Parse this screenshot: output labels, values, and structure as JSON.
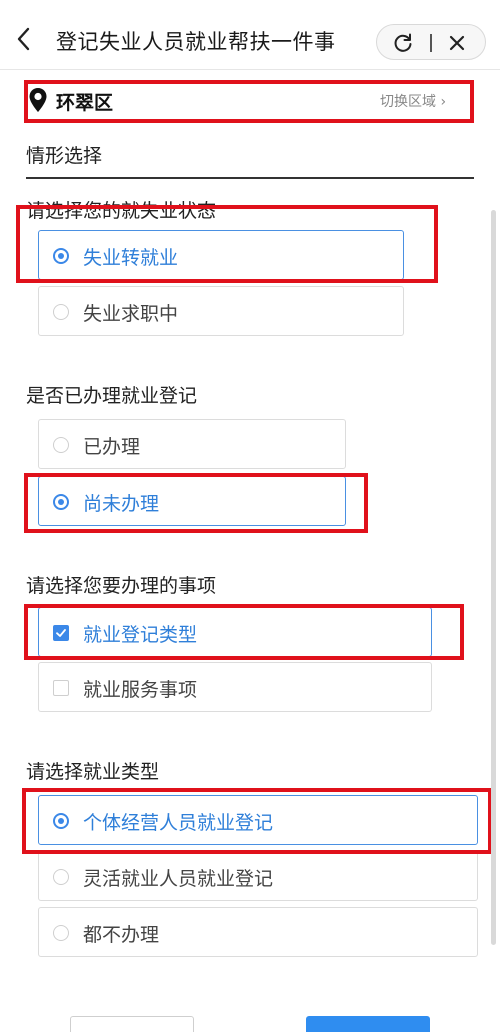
{
  "header": {
    "title": "登记失业人员就业帮扶一件事"
  },
  "location": {
    "name": "环翠区",
    "switch_label": "切换区域 ›"
  },
  "section": {
    "title": "情形选择"
  },
  "questions": [
    {
      "label": "请选择您的就失业状态",
      "type": "radio",
      "options": [
        {
          "label": "失业转就业",
          "selected": true
        },
        {
          "label": "失业求职中",
          "selected": false
        }
      ]
    },
    {
      "label": "是否已办理就业登记",
      "type": "radio",
      "options": [
        {
          "label": "已办理",
          "selected": false
        },
        {
          "label": "尚未办理",
          "selected": true
        }
      ]
    },
    {
      "label": "请选择您要办理的事项",
      "type": "checkbox",
      "options": [
        {
          "label": "就业登记类型",
          "selected": true
        },
        {
          "label": "就业服务事项",
          "selected": false
        }
      ]
    },
    {
      "label": "请选择就业类型",
      "type": "radio",
      "options": [
        {
          "label": "个体经营人员就业登记",
          "selected": true
        },
        {
          "label": "灵活就业人员就业登记",
          "selected": false
        },
        {
          "label": "都不办理",
          "selected": false
        }
      ]
    }
  ],
  "colors": {
    "accent": "#3b88e8",
    "annotation_red": "#e0111b",
    "primary_button": "#2f8df0"
  }
}
